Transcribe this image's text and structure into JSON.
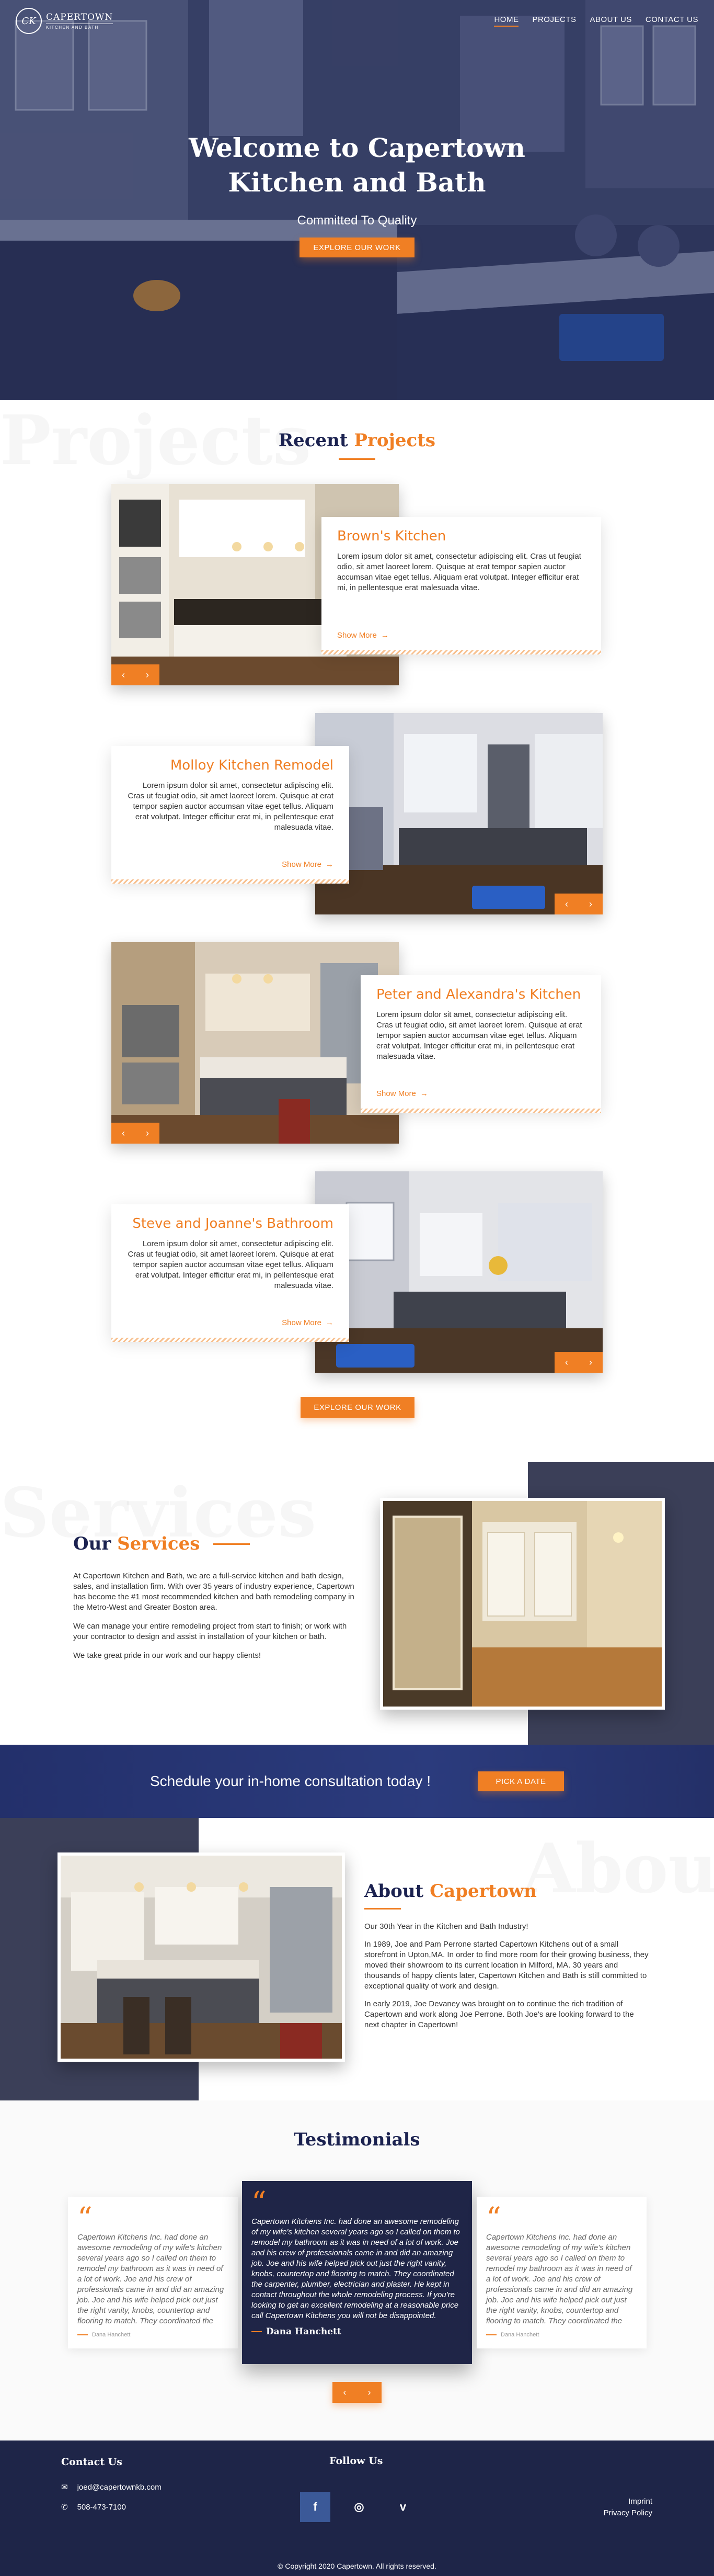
{
  "brand": {
    "logo_initials": "CK",
    "name": "CAPERTOWN",
    "tagline": "KITCHEN AND BATH"
  },
  "nav": {
    "items": [
      {
        "label": "HOME",
        "active": true
      },
      {
        "label": "PROJECTS",
        "active": false
      },
      {
        "label": "ABOUT US",
        "active": false
      },
      {
        "label": "CONTACT US",
        "active": false
      }
    ]
  },
  "hero": {
    "title_line1": "Welcome to Capertown",
    "title_line2": "Kitchen and Bath",
    "subtitle": "Committed To Quality",
    "button": "EXPLORE OUR WORK"
  },
  "projects": {
    "ghost": "Projects",
    "title_prefix": "Recent",
    "title_highlight": "Projects",
    "items": [
      {
        "title": "Brown's Kitchen",
        "text": "Lorem ipsum dolor sit amet, consectetur adipiscing elit. Cras ut feugiat odio, sit amet laoreet lorem. Quisque at erat tempor sapien auctor accumsan vitae eget tellus. Aliquam erat volutpat. Integer efficitur erat mi, in pellentesque erat malesuada vitae.",
        "more": "Show More"
      },
      {
        "title": "Molloy Kitchen Remodel",
        "text": "Lorem ipsum dolor sit amet, consectetur adipiscing elit. Cras ut feugiat odio, sit amet laoreet lorem. Quisque at erat tempor sapien auctor accumsan vitae eget tellus. Aliquam erat volutpat. Integer efficitur erat mi, in pellentesque erat malesuada vitae.",
        "more": "Show More"
      },
      {
        "title": "Peter and Alexandra's Kitchen",
        "text": "Lorem ipsum dolor sit amet, consectetur adipiscing elit. Cras ut feugiat odio, sit amet laoreet lorem. Quisque at erat tempor sapien auctor accumsan vitae eget tellus. Aliquam erat volutpat. Integer efficitur erat mi, in pellentesque erat malesuada vitae.",
        "more": "Show More"
      },
      {
        "title": "Steve and Joanne's Bathroom",
        "text": "Lorem ipsum dolor sit amet, consectetur adipiscing elit. Cras ut feugiat odio, sit amet laoreet lorem. Quisque at erat tempor sapien auctor accumsan vitae eget tellus. Aliquam erat volutpat. Integer efficitur erat mi, in pellentesque erat malesuada vitae.",
        "more": "Show More"
      }
    ],
    "button": "EXPLORE OUR WORK"
  },
  "services": {
    "ghost": "Services",
    "title_prefix": "Our",
    "title_highlight": "Services",
    "p1": "At Capertown Kitchen and Bath, we are a full-service kitchen and bath design, sales, and installation firm. With over 35 years of industry experience, Capertown has become the #1 most recommended kitchen and bath remodeling company in the Metro-West and Greater Boston area.",
    "p2": "We can manage your entire remodeling project from start to finish; or work with your contractor to design and assist in installation of your kitchen or bath.",
    "p3": "We take great pride in our work and our happy clients!"
  },
  "cta": {
    "text": "Schedule your in-home consultation today !",
    "button": "PICK A DATE"
  },
  "about": {
    "ghost": "About",
    "title_prefix": "About",
    "title_highlight": "Capertown",
    "p1": "Our 30th Year in the Kitchen and Bath Industry!",
    "p2": "In 1989, Joe and Pam Perrone started Capertown Kitchens out of a small storefront in Upton,MA. In order to find more room for their growing business, they moved their showroom to its current location in Milford, MA. 30 years and thousands of happy clients later, Capertown Kitchen and Bath is still committed to exceptional quality of work and design.",
    "p3": "In early 2019, Joe Devaney was brought on to continue the rich tradition of Capertown and work along Joe Perrone. Both Joe's are looking forward to the next chapter in Capertown!"
  },
  "testimonials": {
    "title": "Testimonials",
    "quote_mark": "“",
    "side_text": "Capertown Kitchens Inc. had done an awesome remodeling of my wife's kitchen several years ago so I called on them to remodel my bathroom as it was in need of a lot of work. Joe and his crew of professionals came in and did an amazing job. Joe and his wife helped pick out just the right vanity, knobs, countertop and flooring to match. They coordinated the",
    "main_text": "Capertown Kitchens Inc. had done an awesome remodeling of my wife's kitchen several years ago so I called on them to remodel my bathroom as it was in need of a lot of work. Joe and his crew of professionals came in and did an amazing job. Joe and his wife helped pick out just the right vanity, knobs, countertop and flooring to match. They coordinated the carpenter, plumber, electrician and plaster. He kept in contact throughout the whole remodeling process. If you're looking to get an excellent remodeling at a reasonable price call Capertown Kitchens you will not be disappointed.",
    "author": "Dana Hanchett"
  },
  "footer": {
    "contact_title": "Contact Us",
    "email": "joed@capertownkb.com",
    "phone": "508-473-7100",
    "follow_title": "Follow Us",
    "social": [
      "f",
      "ig",
      "v"
    ],
    "imprint": "Imprint",
    "privacy": "Privacy Policy",
    "copyright": "© Copyright 2020  Capertown. All rights reserved."
  },
  "colors": {
    "accent": "#f07f24",
    "navy": "#1b2250",
    "footer": "#1e2548"
  }
}
